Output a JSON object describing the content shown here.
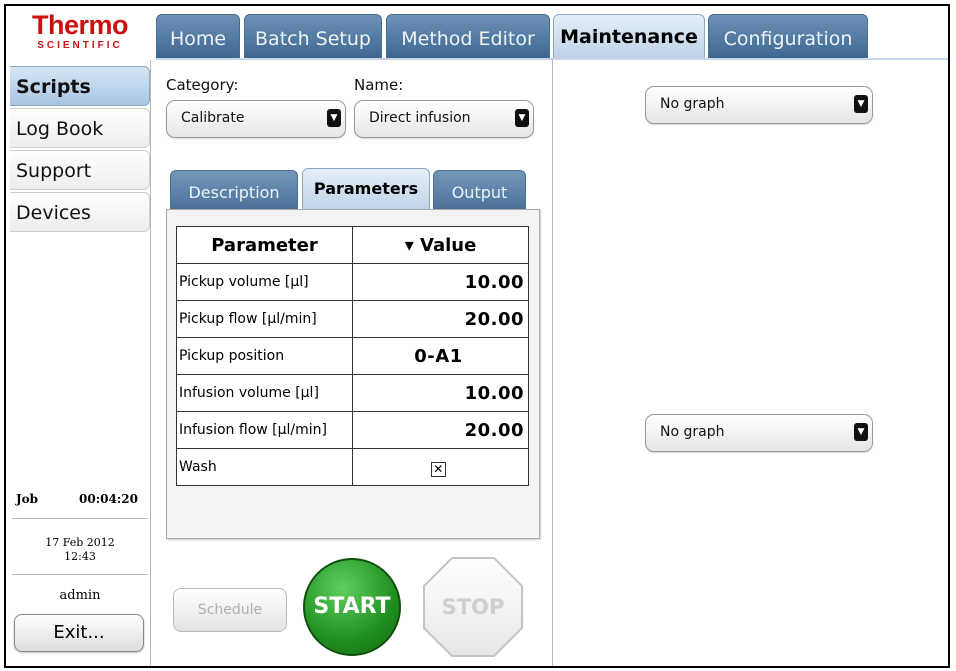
{
  "logo": {
    "brand": "Thermo",
    "sub": "SCIENTIFIC"
  },
  "top_tabs": [
    {
      "label": "Home",
      "active": false
    },
    {
      "label": "Batch Setup",
      "active": false
    },
    {
      "label": "Method Editor",
      "active": false
    },
    {
      "label": "Maintenance",
      "active": true
    },
    {
      "label": "Configuration",
      "active": false
    }
  ],
  "sidebar": {
    "items": [
      {
        "label": "Scripts",
        "active": true
      },
      {
        "label": "Log Book",
        "active": false
      },
      {
        "label": "Support",
        "active": false
      },
      {
        "label": "Devices",
        "active": false
      }
    ]
  },
  "status": {
    "job_label": "Job",
    "job_time": "00:04:20",
    "date": "17 Feb 2012",
    "time": "12:43",
    "user": "admin",
    "exit_label": "Exit..."
  },
  "script": {
    "category_label": "Category:",
    "category_value": "Calibrate",
    "name_label": "Name:",
    "name_value": "Direct infusion"
  },
  "sub_tabs": [
    {
      "label": "Description",
      "active": false
    },
    {
      "label": "Parameters",
      "active": true
    },
    {
      "label": "Output",
      "active": false
    }
  ],
  "param_table": {
    "col_parameter": "Parameter",
    "col_value": "Value",
    "sort_indicator": "▾",
    "rows": [
      {
        "name": "Pickup volume [µl]",
        "value": "10.00"
      },
      {
        "name": "Pickup flow [µl/min]",
        "value": "20.00"
      },
      {
        "name": "Pickup position",
        "value": "0-A1"
      },
      {
        "name": "Infusion volume [µl]",
        "value": "10.00"
      },
      {
        "name": "Infusion flow [µl/min]",
        "value": "20.00"
      },
      {
        "name": "Wash",
        "value": "checked"
      }
    ]
  },
  "actions": {
    "schedule_label": "Schedule",
    "start_label": "START",
    "stop_label": "STOP"
  },
  "graphs": {
    "top_value": "No graph",
    "bottom_value": "No graph"
  },
  "colors": {
    "brand_red": "#cc1010",
    "tab_blue": "#4a719a",
    "tab_active": "#bfd3e7",
    "start_green": "#1f8f1f"
  }
}
